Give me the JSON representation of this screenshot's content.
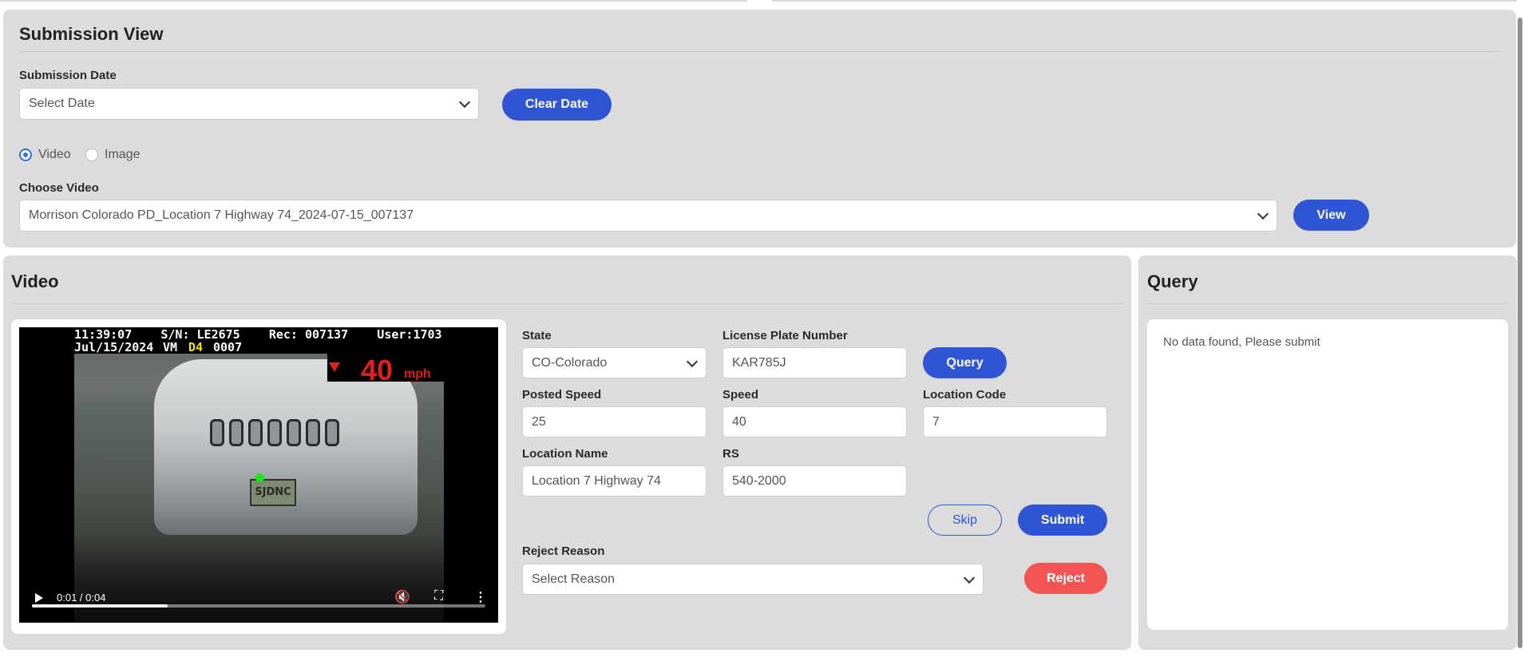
{
  "submission": {
    "title": "Submission View",
    "date_label": "Submission Date",
    "date_placeholder": "Select Date",
    "clear_date": "Clear Date",
    "media_types": [
      "Video",
      "Image"
    ],
    "media_selected": "Video",
    "choose_label": "Choose Video",
    "chosen_video": "Morrison Colorado PD_Location 7 Highway 74_2024-07-15_007137",
    "view_button": "View"
  },
  "video_panel": {
    "title": "Video",
    "osd_line1": "11:39:07    S/N: LE2675    Rec: 007137    User:1703",
    "osd_date": "Jul/15/2024",
    "osd_vm": "VM",
    "osd_d": "D4",
    "osd_num": "0007",
    "speed_value": "40",
    "speed_unit": "mph",
    "plate_text": "SJDNC",
    "current_time": "0:01 / 0:04",
    "progress": 0.3
  },
  "form": {
    "state_label": "State",
    "state_value": "CO-Colorado",
    "plate_label": "License Plate Number",
    "plate_value": "KAR785J",
    "query_button": "Query",
    "posted_speed_label": "Posted Speed",
    "posted_speed_value": "25",
    "speed_label": "Speed",
    "speed_value": "40",
    "location_code_label": "Location Code",
    "location_code_value": "7",
    "location_name_label": "Location Name",
    "location_name_value": "Location 7 Highway 74",
    "rs_label": "RS",
    "rs_value": "540-2000",
    "skip_button": "Skip",
    "submit_button": "Submit",
    "reject_reason_label": "Reject Reason",
    "reject_reason_placeholder": "Select Reason",
    "reject_button": "Reject"
  },
  "query_panel": {
    "title": "Query",
    "message": "No data found, Please submit"
  },
  "colors": {
    "primary": "#2f54d4",
    "danger": "#f25454",
    "card_bg": "#dcdcdc",
    "speed_red": "#e21e1e",
    "marker_green": "#19e619"
  },
  "icons": [
    "chevron-down-icon",
    "play-icon",
    "mute-icon",
    "fullscreen-icon",
    "more-vertical-icon"
  ]
}
